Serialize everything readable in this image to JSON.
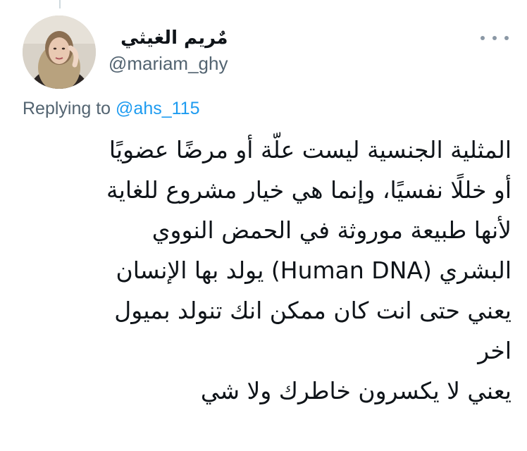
{
  "tweet": {
    "author": {
      "display_name": "مٌريم الغيثي",
      "handle": "@mariam_ghy"
    },
    "reply": {
      "prefix": "Replying to",
      "to_handle": "@ahs_115"
    },
    "more_icon": "more-horizontal-icon",
    "body_lines": [
      "المثلية الجنسية ليست علّة أو مرضًا عضويًا",
      "أو خللًا نفسيًا، وإنما هي خيار مشروع للغاية",
      "لأنها طبيعة موروثة في الحمض النووي",
      "البشري (Human DNA) يولد بها الإنسان",
      "يعني حتى انت كان ممكن انك تنولد بميول",
      "اخر",
      "يعني لا يكسرون خاطرك ولا شي"
    ]
  },
  "colors": {
    "text": "#0f1419",
    "secondary": "#536471",
    "link": "#1d9bf0",
    "thread_line": "#cfd9de"
  }
}
